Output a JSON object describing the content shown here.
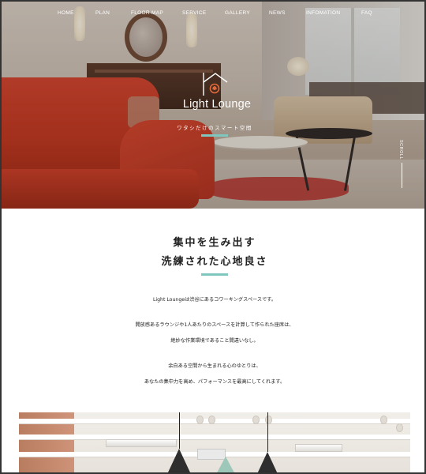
{
  "nav": {
    "items": [
      "HOME",
      "PLAN",
      "FLOOR MAP",
      "SERVICE",
      "GALLERY",
      "NEWS",
      "INFOMATION",
      "FAQ"
    ]
  },
  "hero": {
    "logo_title": "Light Lounge",
    "tagline": "ワタシだけのスマート空間",
    "scroll_label": "SCROLL",
    "accent_color": "#7fc6bf"
  },
  "intro": {
    "heading_line1": "集中を生み出す",
    "heading_line2": "洗練された心地良さ",
    "paragraphs": [
      "Light Loungeは渋谷にあるコワーキングスペースです。",
      "開放感あるラウンジや1人あたりのスペースを計算して作られた座席は、",
      "絶妙な作業環境であること間違いなし。",
      "余白ある空間から生まれる心のゆとりは、",
      "あなたの集中力を高め、パフォーマンスを最高にしてくれます。"
    ]
  }
}
